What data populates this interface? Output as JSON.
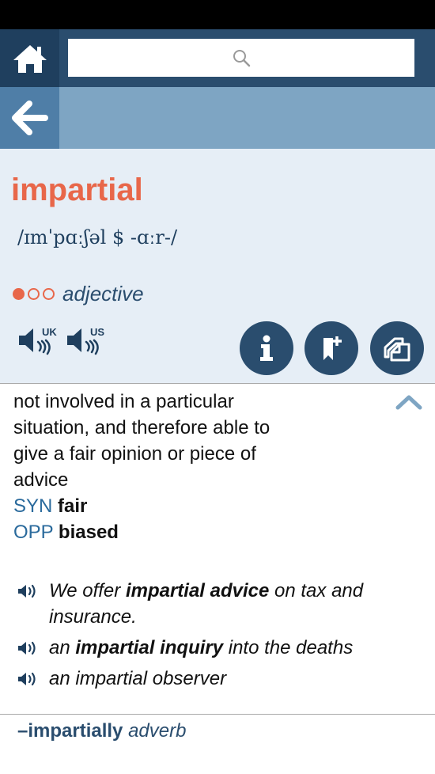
{
  "nav": {
    "home_icon": "home-icon",
    "search_icon": "search-icon",
    "back_icon": "back-arrow-icon"
  },
  "entry": {
    "headword": "impartial",
    "pronunciation": "/ɪmˈpɑːʃəl $ -ɑːr-/",
    "frequency": {
      "filled": 1,
      "total": 3
    },
    "part_of_speech": "adjective",
    "audio": [
      {
        "label": "UK",
        "icon": "speaker-uk-icon"
      },
      {
        "label": "US",
        "icon": "speaker-us-icon"
      }
    ],
    "actions": [
      {
        "icon": "info-icon",
        "glyph": "i"
      },
      {
        "icon": "bookmark-add-icon"
      },
      {
        "icon": "copy-icon"
      }
    ]
  },
  "definition": {
    "lines": [
      "not involved in a particular",
      "situation, and therefore able to",
      "give a fair opinion or piece of",
      "advice"
    ],
    "syn_label": "SYN",
    "syn_word": "fair",
    "opp_label": "OPP",
    "opp_word": "biased"
  },
  "examples": [
    {
      "pre": "We offer ",
      "bold": "impartial advice",
      "post": " on tax and insurance."
    },
    {
      "pre": "an ",
      "bold": "impartial inquiry",
      "post": " into the deaths"
    },
    {
      "pre": "an impartial observer",
      "bold": "",
      "post": ""
    }
  ],
  "runon": {
    "word": "–impartially",
    "pos": "adverb"
  },
  "colors": {
    "accent": "#e8674a",
    "navy": "#2a4d6e",
    "topbar": "#2a4d6e",
    "backbar": "#7ea5c3",
    "entry_bg": "#e6eef6"
  }
}
